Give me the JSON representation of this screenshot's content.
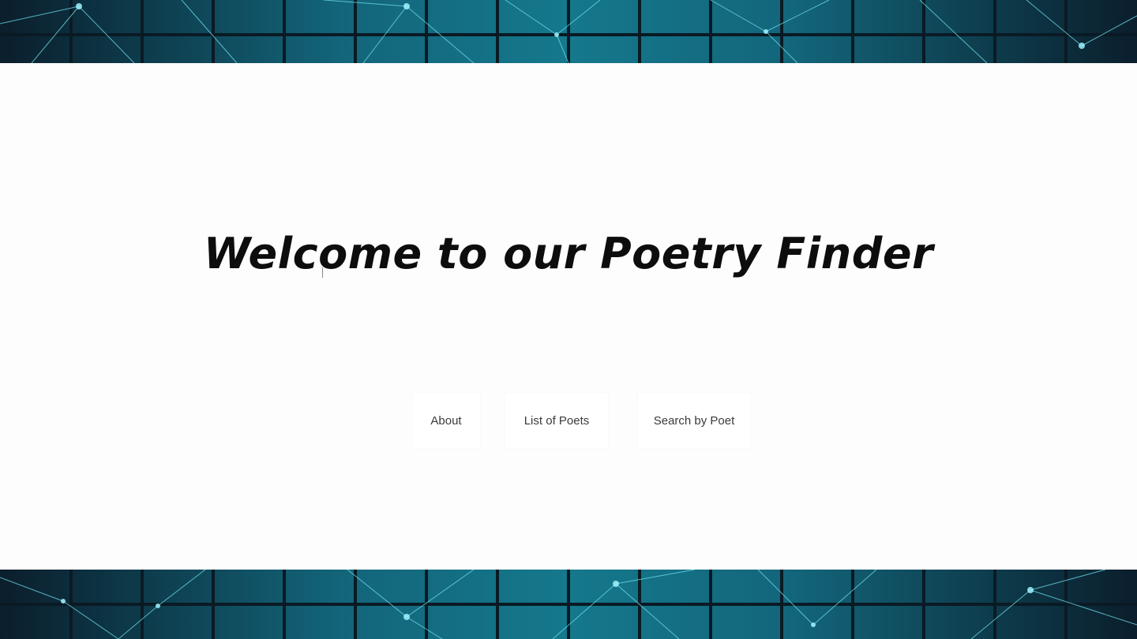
{
  "page": {
    "headline": "Welcome to our Poetry Finder"
  },
  "nav": {
    "items": [
      {
        "label": "About"
      },
      {
        "label": "List of Poets"
      },
      {
        "label": "Search by Poet"
      }
    ]
  },
  "theme": {
    "band_dark": "#0b1e2c",
    "band_mid": "#15788c",
    "line_color": "#5fd6e6",
    "content_bg": "#fdfdfd",
    "text_color": "#0d0d0d"
  }
}
